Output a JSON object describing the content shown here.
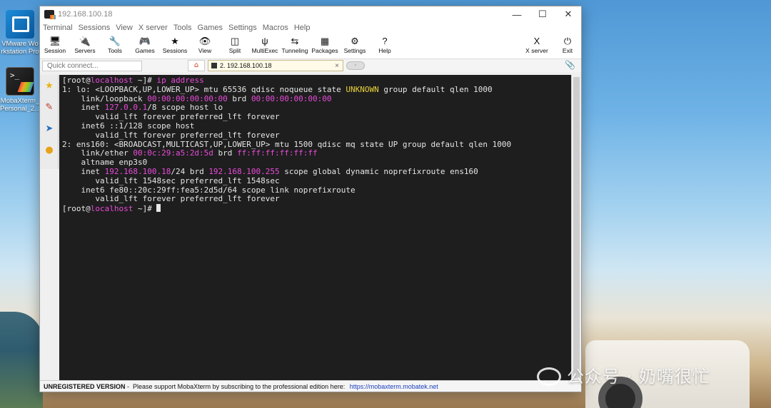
{
  "desktop": {
    "icons": [
      {
        "label_line1": "VMware Wo",
        "label_line2": "rkstation Pro"
      },
      {
        "label_line1": "MobaXterm_",
        "label_line2": "Personal_2..."
      }
    ],
    "watermark": "公众号 · 奶嘴很忙"
  },
  "window": {
    "title": "192.168.100.18",
    "controls": {
      "minimize": "—",
      "maximize": "☐",
      "close": "✕"
    }
  },
  "menu": [
    "Terminal",
    "Sessions",
    "View",
    "X server",
    "Tools",
    "Games",
    "Settings",
    "Macros",
    "Help"
  ],
  "toolbar": {
    "items": [
      {
        "label": "Session",
        "icon": "session-icon",
        "glyph": "🖥"
      },
      {
        "label": "Servers",
        "icon": "servers-icon",
        "glyph": "🔌"
      },
      {
        "label": "Tools",
        "icon": "tools-icon",
        "glyph": "🔧"
      },
      {
        "label": "Games",
        "icon": "games-icon",
        "glyph": "🎮"
      },
      {
        "label": "Sessions",
        "icon": "sessions-icon",
        "glyph": "★"
      },
      {
        "label": "View",
        "icon": "view-icon",
        "glyph": "👁"
      },
      {
        "label": "Split",
        "icon": "split-icon",
        "glyph": "◫"
      },
      {
        "label": "MultiExec",
        "icon": "multiexec-icon",
        "glyph": "ψ"
      },
      {
        "label": "Tunneling",
        "icon": "tunneling-icon",
        "glyph": "⇆"
      },
      {
        "label": "Packages",
        "icon": "packages-icon",
        "glyph": "▦"
      },
      {
        "label": "Settings",
        "icon": "settings-icon",
        "glyph": "⚙"
      },
      {
        "label": "Help",
        "icon": "help-icon",
        "glyph": "?"
      }
    ],
    "right": [
      {
        "label": "X server",
        "icon": "xserver-icon",
        "glyph": "X"
      },
      {
        "label": "Exit",
        "icon": "exit-icon",
        "glyph": "⏻"
      }
    ]
  },
  "tabs": {
    "quick_connect_placeholder": "Quick connect...",
    "home_glyph": "⌂",
    "session_tab_label": "2. 192.168.100.18",
    "close_glyph": "×"
  },
  "terminal": {
    "lines": [
      [
        {
          "t": "[root@"
        },
        {
          "t": "localhost",
          "c": "m"
        },
        {
          "t": " ~]# "
        },
        {
          "t": "ip address",
          "c": "m"
        }
      ],
      [
        {
          "t": "1: lo: <LOOPBACK,UP,LOWER_UP> mtu 65536 qdisc noqueue state "
        },
        {
          "t": "UNKNOWN",
          "c": "y"
        },
        {
          "t": " group default qlen 1000"
        }
      ],
      [
        {
          "t": "    link/loopback "
        },
        {
          "t": "00:00:00:00:00:00",
          "c": "m"
        },
        {
          "t": " brd "
        },
        {
          "t": "00:00:00:00:00:00",
          "c": "m"
        }
      ],
      [
        {
          "t": "    inet "
        },
        {
          "t": "127.0.0.1",
          "c": "m"
        },
        {
          "t": "/8 scope host lo"
        }
      ],
      [
        {
          "t": "       valid_lft forever preferred_lft forever"
        }
      ],
      [
        {
          "t": "    inet6 ::1/128 scope host"
        }
      ],
      [
        {
          "t": "       valid_lft forever preferred_lft forever"
        }
      ],
      [
        {
          "t": "2: ens160: <BROADCAST,MULTICAST,UP,LOWER_UP> mtu 1500 qdisc mq state UP group default qlen 1000"
        }
      ],
      [
        {
          "t": "    link/ether "
        },
        {
          "t": "00:0c:29:a5:2d:5d",
          "c": "m"
        },
        {
          "t": " brd "
        },
        {
          "t": "ff:ff:ff:ff:ff:ff",
          "c": "m"
        }
      ],
      [
        {
          "t": "    altname enp3s0"
        }
      ],
      [
        {
          "t": "    inet "
        },
        {
          "t": "192.168.100.18",
          "c": "m"
        },
        {
          "t": "/24 brd "
        },
        {
          "t": "192.168.100.255",
          "c": "m"
        },
        {
          "t": " scope global dynamic noprefixroute ens160"
        }
      ],
      [
        {
          "t": "       valid_lft 1548sec preferred_lft 1548sec"
        }
      ],
      [
        {
          "t": "    inet6 fe80::20c:29ff:fea5:2d5d/64 scope link noprefixroute"
        }
      ],
      [
        {
          "t": "       valid_lft forever preferred_lft forever"
        }
      ],
      [
        {
          "t": "[root@"
        },
        {
          "t": "localhost",
          "c": "m"
        },
        {
          "t": " ~]# "
        },
        {
          "cursor": true
        }
      ]
    ]
  },
  "status": {
    "unregistered": "UNREGISTERED VERSION",
    "message": " -  Please support MobaXterm by subscribing to the professional edition here: ",
    "link": "https://mobaxterm.mobatek.net"
  }
}
